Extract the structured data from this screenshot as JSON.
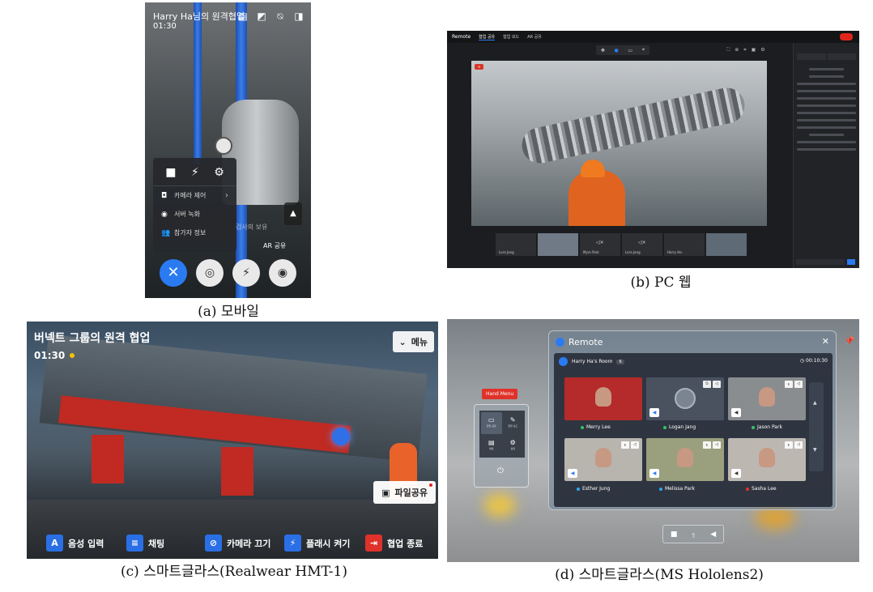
{
  "mobile": {
    "title": "Harry Ha님의 원격협업",
    "time": "01:30",
    "menu_items": [
      {
        "label": "카메라 제어"
      },
      {
        "label": "서버 녹화"
      },
      {
        "label": "참가자 정보"
      }
    ],
    "ar_share": "AR 공유",
    "faint_text": "검사의 보유"
  },
  "pc": {
    "logo": "Remote",
    "nav": [
      "협업 공유",
      "협업 보드",
      "AR 공유"
    ],
    "thumbs": [
      "Lora Jang",
      "",
      "Myro Park",
      "Lora Jang",
      "Harry Ha",
      ""
    ]
  },
  "realwear": {
    "title": "버넥트 그룹의 원격 협업",
    "time": "01:30",
    "menu": "메뉴",
    "file_share": "파일공유",
    "commands": {
      "voice": "음성 입력",
      "chat": "채팅",
      "camera": "카메라 끄기",
      "flash": "플래시 켜기",
      "end": "협업 종료"
    }
  },
  "hololens": {
    "app": "Remote",
    "room": "Harry Ha's Room",
    "count": "6",
    "timer": "00:10:30",
    "hand_menu": "Hand Menu",
    "hand_menu_items": [
      "협업 공유",
      "협업 보드",
      "채팅",
      "설정"
    ],
    "participants": [
      {
        "name": "Merry Lee",
        "status": "#36c36a"
      },
      {
        "name": "Logan Jang",
        "status": "#36c36a"
      },
      {
        "name": "Jason Park",
        "status": "#36c36a"
      },
      {
        "name": "Esther Jung",
        "status": "#2aa8f0"
      },
      {
        "name": "Melissa Park",
        "status": "#2aa8f0"
      },
      {
        "name": "Sasha Lee",
        "status": "#e0322a"
      }
    ]
  },
  "captions": {
    "a": "(a) 모바일",
    "b": "(b) PC 웹",
    "c": "(c) 스마트글라스(Realwear HMT-1)",
    "d": "(d) 스마트글라스(MS Hololens2)"
  }
}
